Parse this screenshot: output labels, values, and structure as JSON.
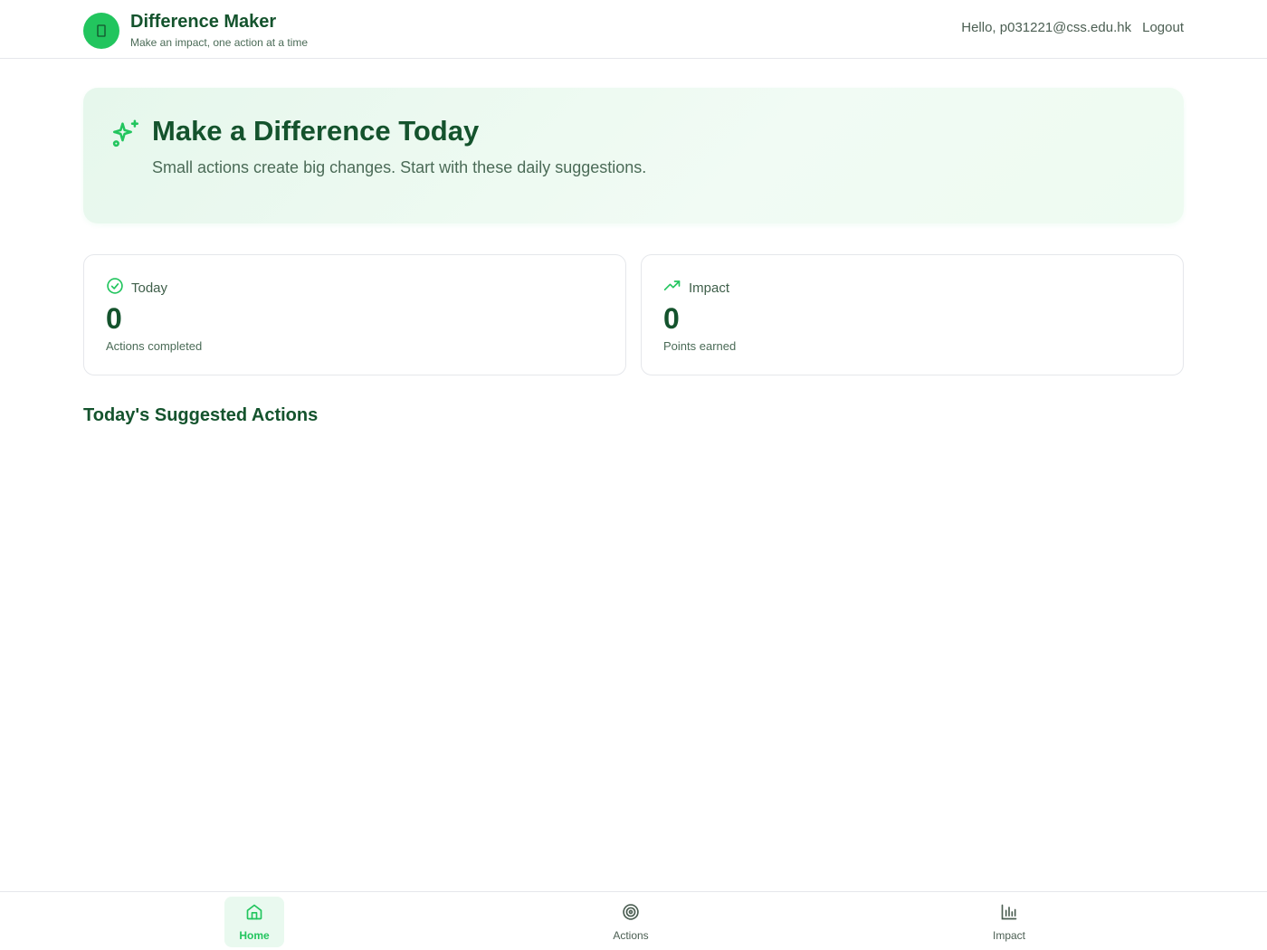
{
  "app": {
    "title": "Difference Maker",
    "tagline": "Make an impact, one action at a time",
    "logo_icon": "leaf-icon"
  },
  "header": {
    "greeting": "Hello, p031221@css.edu.hk",
    "logout_label": "Logout"
  },
  "hero": {
    "icon": "sparkles-icon",
    "title": "Make a Difference Today",
    "subtitle": "Small actions create big changes. Start with these daily suggestions."
  },
  "stats": {
    "today": {
      "icon": "check-circle-icon",
      "label": "Today",
      "value": "0",
      "caption": "Actions completed"
    },
    "impact": {
      "icon": "trending-up-icon",
      "label": "Impact",
      "value": "0",
      "caption": "Points earned"
    }
  },
  "suggested": {
    "title": "Today's Suggested Actions"
  },
  "nav": {
    "home": {
      "label": "Home",
      "icon": "home-icon",
      "active": true
    },
    "actions": {
      "label": "Actions",
      "icon": "target-icon",
      "active": false
    },
    "impact": {
      "label": "Impact",
      "icon": "bar-chart-icon",
      "active": false
    }
  },
  "colors": {
    "accent": "#22c55e",
    "heading": "#14532d",
    "muted": "#4b6b57"
  }
}
